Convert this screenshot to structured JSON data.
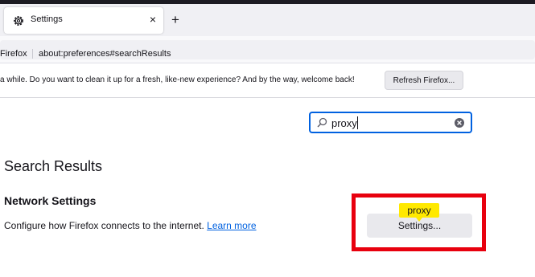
{
  "tab": {
    "title": "Settings",
    "close": "×",
    "new_tab": "+"
  },
  "urlbar": {
    "identity": "Firefox",
    "url": "about:preferences#searchResults"
  },
  "notification": {
    "message": "a while. Do you want to clean it up for a fresh, like-new experience? And by the way, welcome back!",
    "button": "Refresh Firefox..."
  },
  "search": {
    "value": "proxy"
  },
  "results": {
    "heading": "Search Results",
    "section_title": "Network Settings",
    "description": "Configure how Firefox connects to the internet.",
    "learn_more": "Learn more",
    "settings_button": "Settings...",
    "highlight_term": "proxy"
  },
  "colors": {
    "accent": "#0061e0",
    "highlight": "#ffe900",
    "annotation_red": "#e8000e"
  }
}
